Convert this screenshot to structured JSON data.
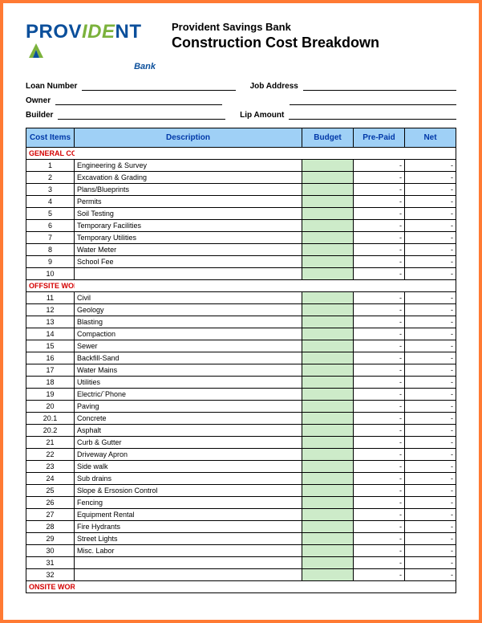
{
  "logo": {
    "word_a": "PROV",
    "word_b": "IDE",
    "word_c": "NT",
    "sub": "Bank"
  },
  "header": {
    "bank_name": "Provident Savings Bank",
    "doc_title": "Construction Cost Breakdown"
  },
  "info": {
    "loan_number_label": "Loan Number",
    "job_address_label": "Job Address",
    "owner_label": "Owner",
    "builder_label": "Builder",
    "lip_amount_label": "Lip Amount"
  },
  "columns": {
    "cost_items": "Cost  Items",
    "description": "Description",
    "budget": "Budget",
    "prepaid": "Pre-Paid",
    "net": "Net"
  },
  "sections": [
    {
      "title": "GENERAL CONDITIONS",
      "rows": [
        {
          "n": "1",
          "d": "Engineering & Survey",
          "p": "-",
          "t": "-"
        },
        {
          "n": "2",
          "d": "Excavation & Grading",
          "p": "-",
          "t": "-"
        },
        {
          "n": "3",
          "d": "Plans/Blueprints",
          "p": "-",
          "t": "-"
        },
        {
          "n": "4",
          "d": "Permits",
          "p": "-",
          "t": "-"
        },
        {
          "n": "5",
          "d": "Soil Testing",
          "p": "-",
          "t": "-"
        },
        {
          "n": "6",
          "d": "Temporary Facilities",
          "p": "-",
          "t": "-"
        },
        {
          "n": "7",
          "d": "Temporary Utilities",
          "p": "-",
          "t": "-"
        },
        {
          "n": "8",
          "d": "Water Meter",
          "p": "-",
          "t": "-"
        },
        {
          "n": "9",
          "d": "School Fee",
          "p": "-",
          "t": "-"
        },
        {
          "n": "10",
          "d": "",
          "p": "-",
          "t": "-"
        }
      ]
    },
    {
      "title": "OFFSITE WORK",
      "rows": [
        {
          "n": "11",
          "d": "Civil",
          "p": "-",
          "t": "-"
        },
        {
          "n": "12",
          "d": "Geology",
          "p": "-",
          "t": "-"
        },
        {
          "n": "13",
          "d": "Blasting",
          "p": "-",
          "t": "-"
        },
        {
          "n": "14",
          "d": "Compaction",
          "p": "-",
          "t": "-"
        },
        {
          "n": "15",
          "d": "Sewer",
          "p": "-",
          "t": "-"
        },
        {
          "n": "16",
          "d": "Backfill-Sand",
          "p": "-",
          "t": "-"
        },
        {
          "n": "17",
          "d": "Water Mains",
          "p": "-",
          "t": "-"
        },
        {
          "n": "18",
          "d": "Utilities",
          "p": "-",
          "t": "-"
        },
        {
          "n": "19",
          "d": "Electric/`Phone",
          "p": "-",
          "t": "-"
        },
        {
          "n": "20",
          "d": "Paving",
          "p": "-",
          "t": "-"
        },
        {
          "n": "20.1",
          "d": "Concrete",
          "p": "-",
          "t": "-"
        },
        {
          "n": "20.2",
          "d": "Asphalt",
          "p": "-",
          "t": "-"
        },
        {
          "n": "21",
          "d": "Curb & Gutter",
          "p": "-",
          "t": "-"
        },
        {
          "n": "22",
          "d": "Driveway Apron",
          "p": "-",
          "t": "-"
        },
        {
          "n": "23",
          "d": "Side walk",
          "p": "-",
          "t": "-"
        },
        {
          "n": "24",
          "d": "Sub drains",
          "p": "-",
          "t": "-"
        },
        {
          "n": "25",
          "d": "Slope & Ersosion Control",
          "p": "-",
          "t": "-"
        },
        {
          "n": "26",
          "d": "Fencing",
          "p": "-",
          "t": "-"
        },
        {
          "n": "27",
          "d": "Equipment Rental",
          "p": "-",
          "t": "-"
        },
        {
          "n": "28",
          "d": "Fire Hydrants",
          "p": "-",
          "t": "-"
        },
        {
          "n": "29",
          "d": "Street Lights",
          "p": "-",
          "t": "-"
        },
        {
          "n": "30",
          "d": "Misc. Labor",
          "p": "-",
          "t": "-"
        },
        {
          "n": "31",
          "d": "",
          "p": "-",
          "t": "-"
        },
        {
          "n": "32",
          "d": "",
          "p": "-",
          "t": "-"
        }
      ]
    },
    {
      "title": "ONSITE WORK",
      "rows": []
    }
  ]
}
